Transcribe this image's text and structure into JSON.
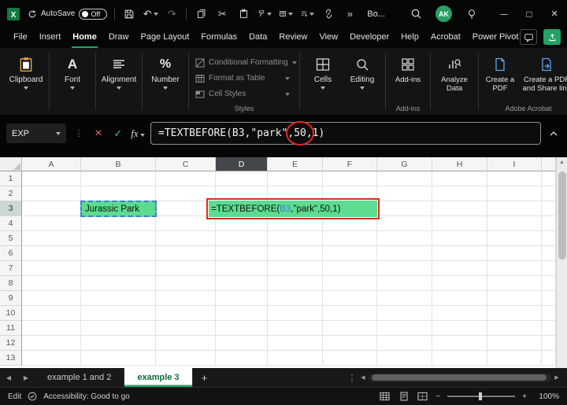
{
  "colors": {
    "accent_green": "#21a366",
    "cell_fill_green": "#5bdc90",
    "annotation_red": "#e02b20",
    "reference_blue": "#3e7bdc"
  },
  "glyphs": {
    "undo": "↶",
    "redo": "↷",
    "cut": "✂",
    "more": "»",
    "vdots": "⋮",
    "check": "✓",
    "cancel": "×",
    "minimize": "─",
    "maximize": "□",
    "close": "×",
    "prev": "◀",
    "next": "▶",
    "up": "▲",
    "minus": "−",
    "plus": "+"
  },
  "titlebar": {
    "autosave_label": "AutoSave",
    "autosave_state": "Off",
    "workbook_name": "Bo...",
    "avatar_initials": "AK"
  },
  "menubar": {
    "items": [
      "File",
      "Insert",
      "Home",
      "Draw",
      "Page Layout",
      "Formulas",
      "Data",
      "Review",
      "View",
      "Developer",
      "Help",
      "Acrobat",
      "Power Pivot"
    ],
    "active": "Home"
  },
  "ribbon": {
    "big_buttons": [
      "Clipboard",
      "Font",
      "Alignment",
      "Number"
    ],
    "styles_menu": [
      "Conditional Formatting",
      "Format as Table",
      "Cell Styles"
    ],
    "styles_group_label": "Styles",
    "cells_button": "Cells",
    "editing_button": "Editing",
    "addins_button": "Add-ins",
    "addins_group_label": "Add-ins",
    "analyze_button": "Analyze Data",
    "create_pdf_button": "Create a PDF",
    "create_pdf_share_button": "Create a PDF and Share link",
    "acrobat_group_label": "Adobe Acrobat"
  },
  "formula_bar": {
    "name_box_value": "EXP",
    "fx_label": "fx",
    "formula_pre": "=TEXTBEFORE(B3,\"park\",",
    "formula_circled": "50",
    "formula_post": ",1)"
  },
  "grid": {
    "columns": [
      "A",
      "B",
      "C",
      "D",
      "E",
      "F",
      "G",
      "H",
      "I"
    ],
    "rows": [
      "1",
      "2",
      "3",
      "4",
      "5",
      "6",
      "7",
      "8",
      "9",
      "10",
      "11",
      "12",
      "13"
    ],
    "selected_column": "D",
    "selected_row": "3",
    "cells": {
      "B3": "Jurassic Park",
      "D3_formula": {
        "pre": "=TEXTBEFORE(",
        "ref": "B3",
        "post": ",\"park\",50,1)"
      }
    }
  },
  "sheet_tabs": {
    "tabs": [
      {
        "label": "example 1 and 2",
        "active": false
      },
      {
        "label": "example 3",
        "active": true
      }
    ],
    "add_tab_label": "+"
  },
  "status_bar": {
    "mode": "Edit",
    "accessibility_text": "Accessibility: Good to go",
    "zoom_level": "100%"
  }
}
